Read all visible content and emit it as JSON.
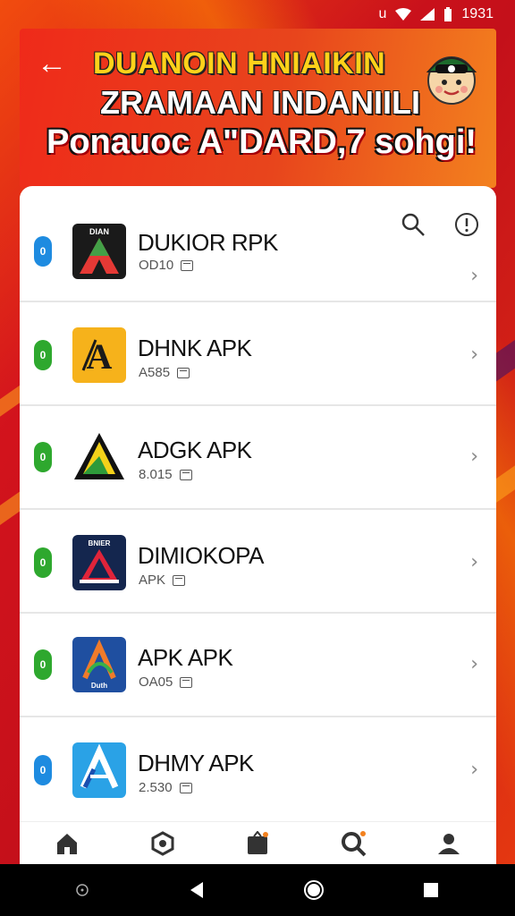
{
  "status_bar": {
    "carrier_icon": "u",
    "time": "1931",
    "icons": [
      "wifi-icon",
      "signal-icon",
      "battery-icon"
    ]
  },
  "banner": {
    "line1": "DUANOIN HNIAIKIN",
    "line2": "ZRAMAAN INDANIILI",
    "line3": "Ponauoc A\"DARD,7 sohgi!",
    "mascot": "mascot-face-icon",
    "back": "back-arrow-icon"
  },
  "apps": [
    {
      "name": "DUKIOR RPK",
      "sub": "OD10",
      "pill_color": "#1e8be0",
      "pill_text": "0",
      "icon": "triangle-multicolor-icon"
    },
    {
      "name": "DHNK APK",
      "sub": "A585",
      "pill_color": "#2ea82e",
      "pill_text": "0",
      "icon": "letter-a-yellow-icon"
    },
    {
      "name": "ADGK APK",
      "sub": "8.015",
      "pill_color": "#2ea82e",
      "pill_text": "0",
      "icon": "triangle-green-yellow-icon"
    },
    {
      "name": "DIMIOKOPA",
      "sub": "APK",
      "pill_color": "#2ea82e",
      "pill_text": "0",
      "icon": "letter-a-navy-icon"
    },
    {
      "name": "APK APK",
      "sub": "OA05",
      "pill_color": "#2ea82e",
      "pill_text": "0",
      "icon": "letter-a-blue-icon"
    },
    {
      "name": "DHMY APK",
      "sub": "2.530",
      "pill_color": "#1e8be0",
      "pill_text": "0",
      "icon": "letter-a-lightblue-icon"
    }
  ],
  "colors": {
    "background": "#d1141c",
    "accent_orange": "#f3811e",
    "banner_yellow": "#ffd21a"
  },
  "bottom_nav": [
    "home-icon",
    "games-icon",
    "apps-icon",
    "search-icon",
    "profile-icon"
  ]
}
